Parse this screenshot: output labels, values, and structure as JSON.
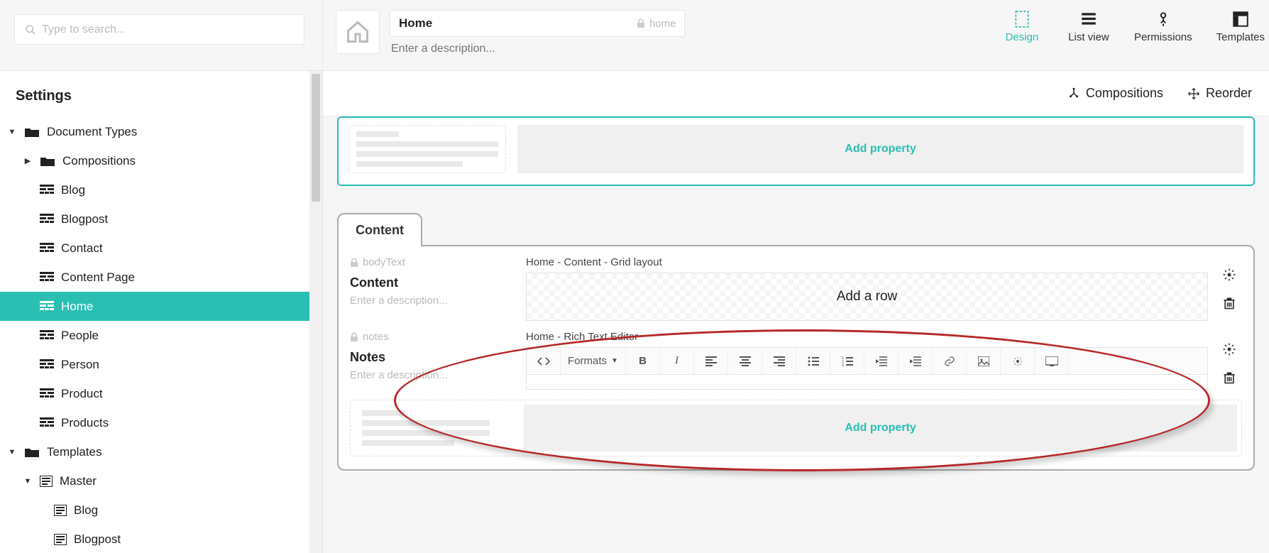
{
  "search": {
    "placeholder": "Type to search..."
  },
  "sidebar": {
    "title": "Settings",
    "nodes": [
      {
        "label": "Document Types"
      },
      {
        "label": "Compositions"
      },
      {
        "label": "Blog"
      },
      {
        "label": "Blogpost"
      },
      {
        "label": "Contact"
      },
      {
        "label": "Content Page"
      },
      {
        "label": "Home"
      },
      {
        "label": "People"
      },
      {
        "label": "Person"
      },
      {
        "label": "Product"
      },
      {
        "label": "Products"
      },
      {
        "label": "Templates"
      },
      {
        "label": "Master"
      },
      {
        "label": "Blog"
      },
      {
        "label": "Blogpost"
      }
    ]
  },
  "doc": {
    "title": "Home",
    "alias": "home",
    "descPlaceholder": "Enter a description..."
  },
  "viewTabs": {
    "design": "Design",
    "listview": "List view",
    "permissions": "Permissions",
    "templates": "Templates"
  },
  "toolbar": {
    "compositions": "Compositions",
    "reorder": "Reorder"
  },
  "topGroup": {
    "addProperty": "Add property"
  },
  "contentGroup": {
    "tab": "Content",
    "props": [
      {
        "alias": "bodyText",
        "name": "Content",
        "descPlaceholder": "Enter a description...",
        "editorLabel": "Home - Content - Grid layout",
        "editorHint": "Add a row"
      },
      {
        "alias": "notes",
        "name": "Notes",
        "descPlaceholder": "Enter a description...",
        "editorLabel": "Home - Rich Text Editor"
      }
    ],
    "addProperty": "Add property",
    "rte": {
      "formats": "Formats"
    }
  }
}
